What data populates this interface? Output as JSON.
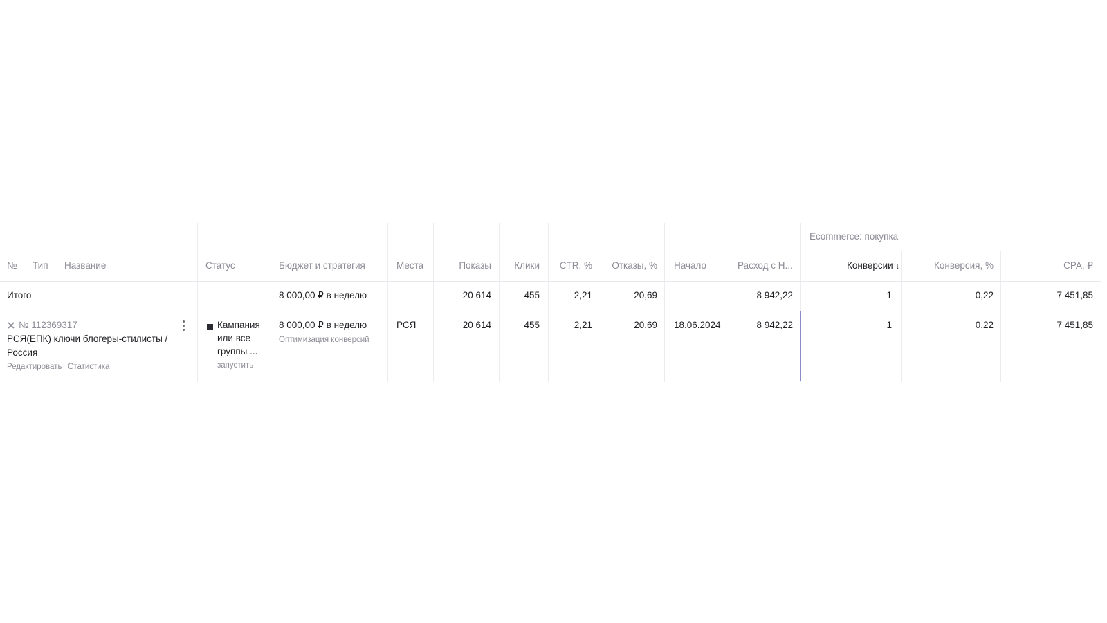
{
  "group_header": {
    "label": "Ecommerce: покупка"
  },
  "columns": {
    "num": "№",
    "type": "Тип",
    "name": "Название",
    "status": "Статус",
    "budget": "Бюджет и стратегия",
    "places": "Места",
    "impressions": "Показы",
    "clicks": "Клики",
    "ctr": "CTR, %",
    "bounces": "Отказы, %",
    "start": "Начало",
    "spend": "Расход с Н...",
    "conversions": "Конверсии",
    "conversions_sort": "↓",
    "conv_rate": "Конверсия, %",
    "cpa": "CPA, ₽"
  },
  "total": {
    "label": "Итого",
    "budget": "8 000,00 ₽ в неделю",
    "impressions": "20 614",
    "clicks": "455",
    "ctr": "2,21",
    "bounces": "20,69",
    "spend": "8 942,22",
    "conversions": "1",
    "conv_rate": "0,22",
    "cpa": "7 451,85"
  },
  "campaign": {
    "id": "№ 112369317",
    "name_line1": "РСЯ(ЕПК) ключи блогеры-стилисты /",
    "name_line2": "Россия",
    "edit": "Редактировать",
    "stats": "Статистика",
    "status_line1": "Кампания",
    "status_line2": "или все",
    "status_line3": "группы ...",
    "status_action": "запустить",
    "budget": "8 000,00 ₽ в неделю",
    "strategy": "Оптимизация конверсий",
    "places": "РСЯ",
    "impressions": "20 614",
    "clicks": "455",
    "ctr": "2,21",
    "bounces": "20,69",
    "start": "18.06.2024",
    "spend": "8 942,22",
    "conversions": "1",
    "conv_rate": "0,22",
    "cpa": "7 451,85"
  },
  "icons": {
    "type_icon": "rsya-network-icon",
    "menu_icon": "more-vertical-icon",
    "status_icon": "stopped-square-icon"
  }
}
